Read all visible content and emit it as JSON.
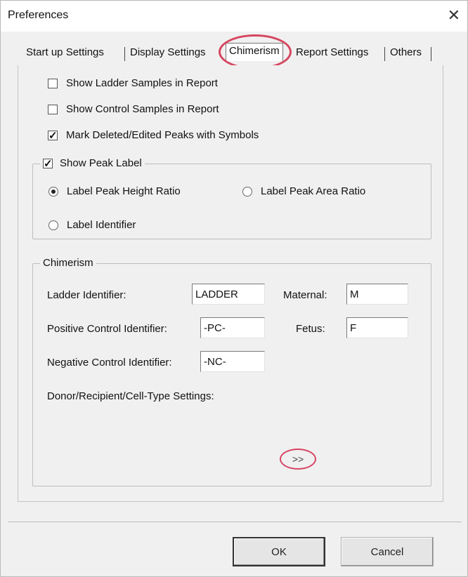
{
  "window": {
    "title": "Preferences"
  },
  "tabs": [
    {
      "label": "Start up Settings"
    },
    {
      "label": "Display Settings"
    },
    {
      "label": "Chimerism"
    },
    {
      "label": "Report Settings"
    },
    {
      "label": "Others"
    }
  ],
  "options": {
    "show_ladder": {
      "label": "Show Ladder Samples in Report",
      "checked": false
    },
    "show_control": {
      "label": "Show Control Samples in Report",
      "checked": false
    },
    "mark_deleted": {
      "label": "Mark Deleted/Edited Peaks with Symbols",
      "checked": true
    }
  },
  "peak_label": {
    "checkbox_label": "Show Peak Label",
    "checked": true,
    "radios": {
      "height": {
        "label": "Label Peak Height Ratio",
        "selected": true
      },
      "area": {
        "label": "Label Peak Area Ratio",
        "selected": false
      },
      "identifier": {
        "label": "Label Identifier",
        "selected": false
      }
    }
  },
  "chimerism": {
    "legend": "Chimerism",
    "ladder": {
      "label": "Ladder Identifier:",
      "value": "LADDER"
    },
    "maternal": {
      "label": "Maternal:",
      "value": "M"
    },
    "positive": {
      "label": "Positive Control Identifier:",
      "value": "-PC-"
    },
    "fetus": {
      "label": "Fetus:",
      "value": "F"
    },
    "negative": {
      "label": "Negative Control Identifier:",
      "value": "-NC-"
    },
    "donor": {
      "label": "Donor/Recipient/Cell-Type Settings:",
      "button": ">>"
    }
  },
  "buttons": {
    "ok": "OK",
    "cancel": "Cancel"
  },
  "colors": {
    "highlight": "#d6455f",
    "window_bg": "#f0f0f0"
  },
  "icons": {
    "close": "close-icon",
    "check": "check-icon"
  }
}
